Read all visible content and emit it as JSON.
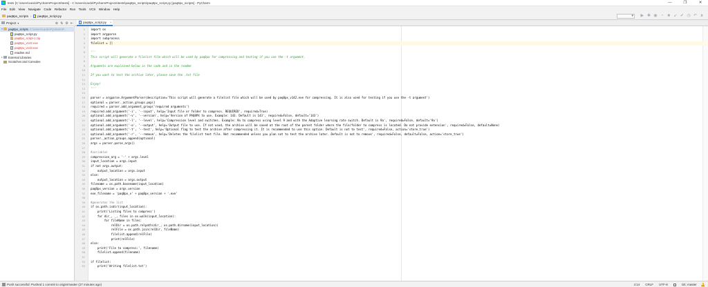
{
  "window": {
    "title": "tests [C:\\Users\\cardo\\PycharmProjects\\tests] - C:\\Users\\cardo\\PycharmProjects\\tests\\paq8px_scripts\\paq8px_script.py [paq8px_scripts] - PyCharm",
    "minimize_glyph": "—",
    "maximize_glyph": "❐",
    "close_glyph": "✕"
  },
  "menu": [
    "File",
    "Edit",
    "View",
    "Navigate",
    "Code",
    "Refactor",
    "Run",
    "Tools",
    "VCS",
    "Window",
    "Help"
  ],
  "breadcrumb": {
    "folder": "paq8px_scripts",
    "separator": "›",
    "file": "paq8px_script.py"
  },
  "toolbar": {
    "icons": [
      "run-icon",
      "debug-icon",
      "coverage-icon",
      "profile-icon",
      "stop-icon",
      "vcs-update-icon",
      "vcs-commit-icon",
      "history-icon",
      "revert-icon",
      "search-icon"
    ],
    "glyphs": [
      "▶",
      "✱",
      "◉",
      "◔",
      "■",
      "↙",
      "✔",
      "◷",
      "↶",
      "⌕"
    ]
  },
  "project_panel": {
    "label": "Project",
    "caret": "▾",
    "tools": [
      "⊕",
      "⇅",
      "⚙",
      "⇤"
    ],
    "tree": [
      {
        "arrow": "▾",
        "icon": "folder",
        "label": "paq8px_scripts",
        "hint": "C:\\Users\\cardo\\PycharmP...",
        "selected": true,
        "indent": 0
      },
      {
        "arrow": "",
        "icon": "py",
        "label": "paq8px_script.py",
        "hint": "",
        "selected": false,
        "indent": 1
      },
      {
        "arrow": "",
        "icon": "zip",
        "label": "paq8px_script-1.zip",
        "hint": "",
        "selected": false,
        "indent": 1,
        "red": true
      },
      {
        "arrow": "",
        "icon": "exe",
        "label": "paq8px_v142.exe",
        "hint": "",
        "selected": false,
        "indent": 1,
        "red": true
      },
      {
        "arrow": "",
        "icon": "exe",
        "label": "paq8px_v143.exe",
        "hint": "",
        "selected": false,
        "indent": 1,
        "red": true
      },
      {
        "arrow": "",
        "icon": "txt",
        "label": "readme.md",
        "hint": "",
        "selected": false,
        "indent": 1
      },
      {
        "arrow": "▸",
        "icon": "lib",
        "label": "External Libraries",
        "hint": "",
        "selected": false,
        "indent": 0
      },
      {
        "arrow": "",
        "icon": "scratch",
        "label": "Scratches and Consoles",
        "hint": "",
        "selected": false,
        "indent": 0
      }
    ]
  },
  "editor": {
    "tab_label": "paq8px_script.py",
    "tab_close": "×",
    "current_line": 4,
    "lines": [
      {
        "n": "1",
        "t": "import os",
        "k": "code"
      },
      {
        "n": "2",
        "t": "import argparse",
        "k": "code"
      },
      {
        "n": "3",
        "t": "import subprocess",
        "k": "code"
      },
      {
        "n": "4",
        "t": "filelist = []",
        "k": "code"
      },
      {
        "n": "5",
        "t": "",
        "k": "code"
      },
      {
        "n": "6",
        "t": "'''",
        "k": "doc"
      },
      {
        "n": "7",
        "t": "This script will generate a filelist file which will be used by paq8px for compressing and testing if you use the -t argument.",
        "k": "doc"
      },
      {
        "n": "8",
        "t": "",
        "k": "doc"
      },
      {
        "n": "9",
        "t": "Arguments are explained below in the code and in the readme",
        "k": "doc"
      },
      {
        "n": "10",
        "t": "",
        "k": "doc"
      },
      {
        "n": "11",
        "t": "If you want to test the archive later, please save the .txt file",
        "k": "doc"
      },
      {
        "n": "12",
        "t": "",
        "k": "doc"
      },
      {
        "n": "13",
        "t": "Enjoy!",
        "k": "doc"
      },
      {
        "n": "14",
        "t": "'''",
        "k": "doc"
      },
      {
        "n": "15",
        "t": "",
        "k": "code"
      },
      {
        "n": "16",
        "t": "parser = argparse.ArgumentParser(description='This script will generate a filelist file which will be used by paq8px_v142.exe for compressing. It is also used for testing if you use the -t argument')",
        "k": "code"
      },
      {
        "n": "17",
        "t": "optional = parser._action_groups.pop()",
        "k": "code"
      },
      {
        "n": "18",
        "t": "required = parser.add_argument_group('required arguments')",
        "k": "code"
      },
      {
        "n": "19",
        "t": "required.add_argument('-i', '--input', help='Input file or folder to compress. REQUIRED', required=True)",
        "k": "code"
      },
      {
        "n": "20",
        "t": "optional.add_argument('-v', '--version', help='Version of PAQ8PX to use. Example: 143. Default is 143', required=False, default='143')",
        "k": "code"
      },
      {
        "n": "21",
        "t": "optional.add_argument('-l', '--level', help='Compression level and switches. Example: 9a to compress using level 9 and with the Adaptive learning rate switch. Default is 9a', required=False, default='9a')",
        "k": "code"
      },
      {
        "n": "22",
        "t": "optional.add_argument('-o', '--output', help='Output file to use. If not used, the archive will be saved at the root of the parent folder where the file/folder to compress is located. Do not provide extension', required=False, default=None)",
        "k": "code"
      },
      {
        "n": "23",
        "t": "optional.add_argument('-t', '--test', help='Optional flag to test the archive after compressing it. It is recommended to use this option. Default is not to test', required=False, action='store_true')",
        "k": "code"
      },
      {
        "n": "24",
        "t": "optional.add_argument('-r', '--remove', help='Deletes the filelist text file. Not recommended unless you plan not to test the archive later. Default is not to remove', required=False, default=False, action='store_true')",
        "k": "code"
      },
      {
        "n": "25",
        "t": "parser._action_groups.append(optional)",
        "k": "code"
      },
      {
        "n": "26",
        "t": "args = parser.parse_args()",
        "k": "code"
      },
      {
        "n": "27",
        "t": "",
        "k": "code"
      },
      {
        "n": "28",
        "t": "#variables",
        "k": "comment"
      },
      {
        "n": "29",
        "t": "compression_arg = '-' + args.level",
        "k": "code"
      },
      {
        "n": "30",
        "t": "input_location = args.input",
        "k": "code"
      },
      {
        "n": "31",
        "t": "if not args.output:",
        "k": "code"
      },
      {
        "n": "32",
        "t": "    output_location = args.input",
        "k": "code"
      },
      {
        "n": "33",
        "t": "else:",
        "k": "code"
      },
      {
        "n": "34",
        "t": "    output_location = args.output",
        "k": "code"
      },
      {
        "n": "35",
        "t": "filename = os.path.basename(input_location)",
        "k": "code"
      },
      {
        "n": "36",
        "t": "paq8px_version = args.version",
        "k": "code"
      },
      {
        "n": "37",
        "t": "exe_filename = 'paq8px_v' + paq8px_version + '.exe'",
        "k": "code"
      },
      {
        "n": "38",
        "t": "",
        "k": "code"
      },
      {
        "n": "39",
        "t": "#generates the list",
        "k": "comment"
      },
      {
        "n": "40",
        "t": "if os.path.isdir(input_location):",
        "k": "code"
      },
      {
        "n": "41",
        "t": "    print('Listing files to compress')",
        "k": "code"
      },
      {
        "n": "42",
        "t": "    for dir_, _, files in os.walk(input_location):",
        "k": "code"
      },
      {
        "n": "43",
        "t": "        for fileName in files:",
        "k": "code"
      },
      {
        "n": "44",
        "t": "            relDir = os.path.relpath(dir_, os.path.dirname(input_location))",
        "k": "code"
      },
      {
        "n": "45",
        "t": "            relFile = os.path.join(relDir, fileName)",
        "k": "code"
      },
      {
        "n": "46",
        "t": "            filelist.append(relFile)",
        "k": "code"
      },
      {
        "n": "47",
        "t": "            print(relFile)",
        "k": "code"
      },
      {
        "n": "48",
        "t": "else:",
        "k": "code"
      },
      {
        "n": "49",
        "t": "    print('File to compress:', filename)",
        "k": "code"
      },
      {
        "n": "50",
        "t": "    filelist.append(filename)",
        "k": "code"
      },
      {
        "n": "51",
        "t": "",
        "k": "code"
      },
      {
        "n": "52",
        "t": "if filelist:",
        "k": "code"
      },
      {
        "n": "53",
        "t": "    print('Writing filelist.txt')",
        "k": "code"
      }
    ]
  },
  "status": {
    "message": "Push successful: Pushed 1 commit to origin/master (27 minutes ago)",
    "position": "4:14",
    "line_sep": "CRLF",
    "encoding": "UTF-8",
    "branch": "Git: master",
    "bell": "🔔"
  },
  "colors": {
    "accent": "#4083c9",
    "current_line": "#fffae3",
    "selection": "#d5e1f5"
  }
}
